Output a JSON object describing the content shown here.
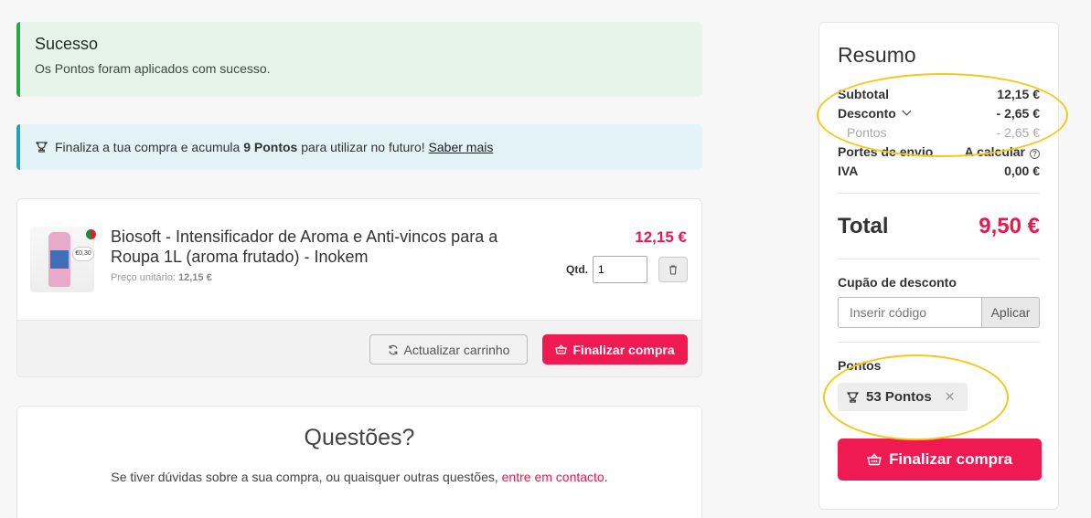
{
  "alerts": {
    "success_title": "Sucesso",
    "success_message": "Os Pontos foram aplicados com sucesso.",
    "info_prefix": "Finaliza a tua compra e acumula",
    "info_points": "9 Pontos",
    "info_suffix": "para utilizar no futuro!",
    "info_link": "Saber mais"
  },
  "cart": {
    "product_name": "Biosoft - Intensificador de Aroma e Anti-vincos para a Roupa 1L (aroma frutado) - Inokem",
    "unit_label": "Preço unitário:",
    "unit_price": "12,15 €",
    "price": "12,15 €",
    "qty_label": "Qtd.",
    "qty_value": "1",
    "image_badge": "€0,30",
    "update_button": "Actualizar carrinho",
    "checkout_button": "Finalizar compra"
  },
  "questions": {
    "title": "Questões?",
    "text": "Se tiver dúvidas sobre a sua compra, ou quaisquer outras questões,",
    "link": "entre em contacto",
    "end": "."
  },
  "summary": {
    "title": "Resumo",
    "subtotal_label": "Subtotal",
    "subtotal_value": "12,15 €",
    "discount_label": "Desconto",
    "discount_value": "- 2,65 €",
    "points_sub_label": "Pontos",
    "points_sub_value": "- 2,65 €",
    "shipping_label": "Portes de envio",
    "shipping_value": "A calcular",
    "vat_label": "IVA",
    "vat_value": "0,00 €",
    "total_label": "Total",
    "total_value": "9,50 €",
    "coupon_title": "Cupão de desconto",
    "coupon_placeholder": "Inserir código",
    "coupon_button": "Aplicar",
    "points_title": "Pontos",
    "points_chip": "53 Pontos",
    "checkout_button": "Finalizar compra"
  },
  "colors": {
    "accent": "#ef1a52",
    "success": "#2aa74a",
    "info": "#25a0b6",
    "highlight": "#f2c919"
  },
  "icons": [
    "trophy-icon",
    "trash-icon",
    "refresh-icon",
    "basket-icon",
    "info-icon",
    "chevron-down-icon",
    "close-icon"
  ]
}
